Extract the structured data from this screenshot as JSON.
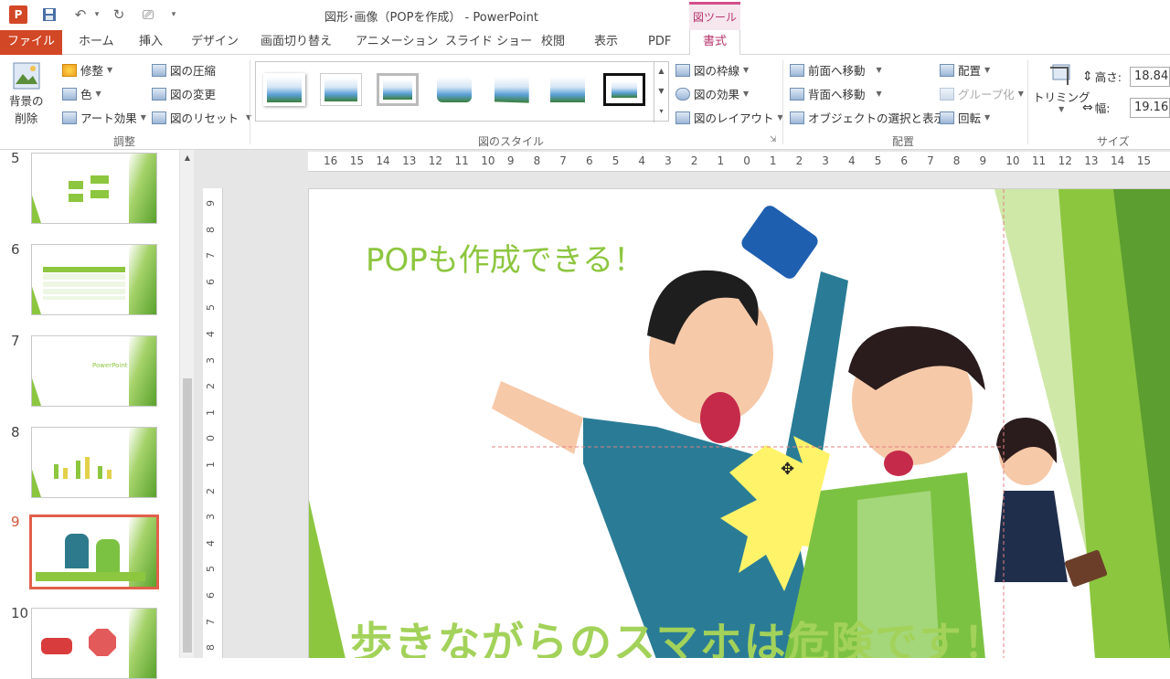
{
  "window": {
    "title": "図形･画像（POPを作成） - PowerPoint",
    "context_group": "図ツール"
  },
  "tabs": [
    "ファイル",
    "ホーム",
    "挿入",
    "デザイン",
    "画面切り替え",
    "アニメーション",
    "スライド ショー",
    "校閲",
    "表示",
    "PDF",
    "書式"
  ],
  "ribbon": {
    "remove_bg": [
      "背景の",
      "削除"
    ],
    "adjust": {
      "corrections": "修整",
      "color": "色",
      "artistic": "アート効果",
      "compress": "図の圧縮",
      "change": "図の変更",
      "reset": "図のリセット",
      "label": "調整"
    },
    "styles": {
      "border": "図の枠線",
      "effects": "図の効果",
      "layout": "図のレイアウト",
      "label": "図のスタイル"
    },
    "arrange": {
      "bring_forward": "前面へ移動",
      "send_backward": "背面へ移動",
      "selection_pane": "オブジェクトの選択と表示",
      "align": "配置",
      "group": "グループ化",
      "rotate": "回転",
      "label": "配置"
    },
    "size": {
      "crop": "トリミング",
      "height_label": "高さ:",
      "height_value": "18.84",
      "width_label": "幅:",
      "width_value": "19.16",
      "label": "サイズ"
    }
  },
  "slides_panel": {
    "items": [
      {
        "number": "5",
        "caption": ""
      },
      {
        "number": "6",
        "caption": ""
      },
      {
        "number": "7",
        "caption": "PowerPoint"
      },
      {
        "number": "8",
        "caption": ""
      },
      {
        "number": "9",
        "caption": ""
      },
      {
        "number": "10",
        "caption": ""
      }
    ],
    "selected": "9"
  },
  "ruler": {
    "horizontal": [
      "16",
      "15",
      "14",
      "13",
      "12",
      "11",
      "10",
      "9",
      "8",
      "7",
      "6",
      "5",
      "4",
      "3",
      "2",
      "1",
      "0",
      "1",
      "2",
      "3",
      "4",
      "5",
      "6",
      "7",
      "8",
      "9",
      "10",
      "11",
      "12",
      "13",
      "14",
      "15"
    ],
    "vertical": [
      "9",
      "8",
      "7",
      "6",
      "5",
      "4",
      "3",
      "2",
      "1",
      "0",
      "1",
      "2",
      "3",
      "4",
      "5",
      "6",
      "7",
      "8"
    ]
  },
  "slide": {
    "title": "POPも作成できる！",
    "caption": "歩きながらのスマホは危険です！"
  },
  "colors": {
    "accent_green": "#8dc63f",
    "file_tab": "#d24726",
    "context_pink": "#b5356e"
  }
}
